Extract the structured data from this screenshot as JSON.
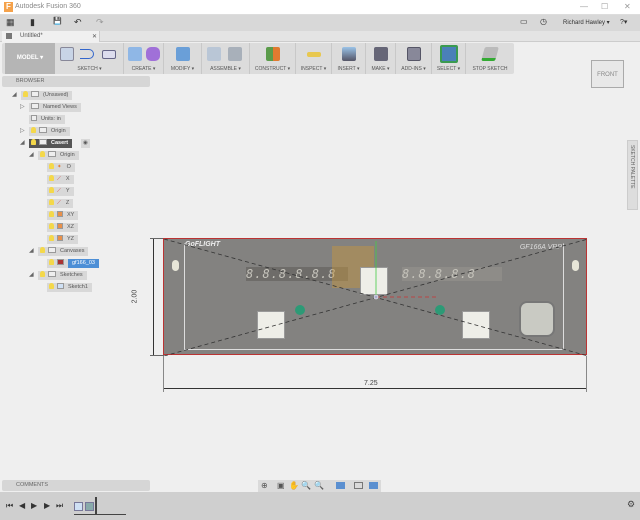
{
  "window": {
    "title": "Autodesk Fusion 360",
    "app_logo": "F",
    "minimize": "—",
    "maximize": "☐",
    "close": "✕"
  },
  "quick_access": {
    "grid_icon": "▦",
    "file_icon": "▮",
    "save_icon": "💾",
    "undo_icon": "↶",
    "redo_icon": "↷",
    "user": "Richard Hawley ▾",
    "help": "?▾",
    "notify_icon": "▭",
    "clock_icon": "◷"
  },
  "document_tab": {
    "label": "Untitled*",
    "close": "✕"
  },
  "ribbon": {
    "workspace": "MODEL ▾",
    "groups": [
      {
        "label": "SKETCH ▾"
      },
      {
        "label": "CREATE ▾"
      },
      {
        "label": "MODIFY ▾"
      },
      {
        "label": "ASSEMBLE ▾"
      },
      {
        "label": "CONSTRUCT ▾"
      },
      {
        "label": "INSPECT ▾"
      },
      {
        "label": "INSERT ▾"
      },
      {
        "label": "MAKE ▾"
      },
      {
        "label": "ADD-INS ▾"
      },
      {
        "label": "SELECT ▾"
      },
      {
        "label": "STOP SKETCH"
      }
    ]
  },
  "viewcube": {
    "face": "FRONT"
  },
  "browser": {
    "title": "BROWSER",
    "nodes": [
      {
        "label": "(Unsaved)"
      },
      {
        "label": "Named Views"
      },
      {
        "label": "Units: in"
      },
      {
        "label": "Origin"
      },
      {
        "label": "Casert"
      },
      {
        "label": "Origin"
      },
      {
        "label": "O"
      },
      {
        "label": "X"
      },
      {
        "label": "Y"
      },
      {
        "label": "Z"
      },
      {
        "label": "XY"
      },
      {
        "label": "XZ"
      },
      {
        "label": "YZ"
      },
      {
        "label": "Canvases"
      },
      {
        "label": "gf166_03"
      },
      {
        "label": "Sketches"
      },
      {
        "label": "Sketch1"
      }
    ]
  },
  "sketch_palette": {
    "label": "SKETCH PALETTE"
  },
  "canvas": {
    "brand": "GoFLIGHT",
    "model": "GF166A VRP",
    "left_display": "8.8.8.8.8.8",
    "right_display": "8.8.8.8.8"
  },
  "dimensions": {
    "width": "7.25",
    "height": "2.00"
  },
  "comments": {
    "title": "COMMENTS"
  },
  "timeline": {
    "first": "⏮",
    "prev": "◀",
    "play": "▶",
    "next": "▶",
    "last": "⏭"
  }
}
